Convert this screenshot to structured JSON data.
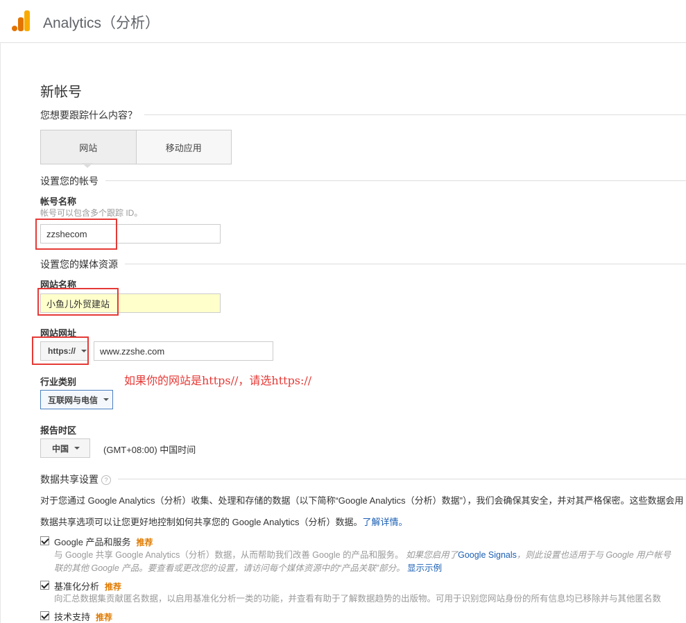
{
  "header": {
    "title": "Analytics（分析）",
    "logo_colors": [
      "#F9AB00",
      "#E37400"
    ]
  },
  "page": {
    "title": "新帐号"
  },
  "tracking": {
    "question": "您想要跟踪什么内容？",
    "options": [
      "网站",
      "移动应用"
    ],
    "selected": "网站"
  },
  "account": {
    "section": "设置您的帐号",
    "name_label": "帐号名称",
    "name_hint": "帐号可以包含多个跟踪 ID。",
    "name_value": "zzshecom"
  },
  "property": {
    "section": "设置您的媒体资源",
    "site_name_label": "网站名称",
    "site_name_value": "小鱼儿外贸建站",
    "url_label": "网站网址",
    "protocol": "https://",
    "url_value": "www.zzshe.com",
    "annotation": "如果你的网站是https//，请选https://",
    "industry_label": "行业类别",
    "industry_value": "互联网与电信",
    "timezone_label": "报告时区",
    "country": "中国",
    "timezone": "(GMT+08:00) 中国时间"
  },
  "sharing": {
    "section": "数据共享设置",
    "help_icon": "?",
    "para1": "对于您通过 Google Analytics（分析）收集、处理和存储的数据（以下简称“Google Analytics（分析）数据”），我们会确保其安全，并对其严格保密。这些数据会用",
    "para2": "数据共享选项可以让您更好地控制如何共享您的 Google Analytics（分析）数据。",
    "learn_more": "了解详情。",
    "options": [
      {
        "label": "Google 产品和服务",
        "badge": "推荐",
        "checked": true,
        "desc1_a": "与 Google 共享 Google Analytics（分析）数据，从而帮助我们改善 Google 的产品和服务。",
        "desc1_italic": "如果您启用了",
        "desc1_link": "Google Signals",
        "desc1_italic2": "，则此设置也适用于与 Google 用户帐号",
        "desc2_italic": "联的其他 Google 产品。要查看或更改您的设置，请访问每个媒体资源中的“产品关联”部分。",
        "desc2_link": "显示示例"
      },
      {
        "label": "基准化分析",
        "badge": "推荐",
        "checked": true,
        "desc1_a": "向汇总数据集贡献匿名数据，以启用基准化分析一类的功能，并查看有助于了解数据趋势的出版物。可用于识别您网站身份的所有信息均已移除并与其他匿名数"
      },
      {
        "label": "技术支持",
        "badge": "推荐",
        "checked": true
      }
    ]
  }
}
